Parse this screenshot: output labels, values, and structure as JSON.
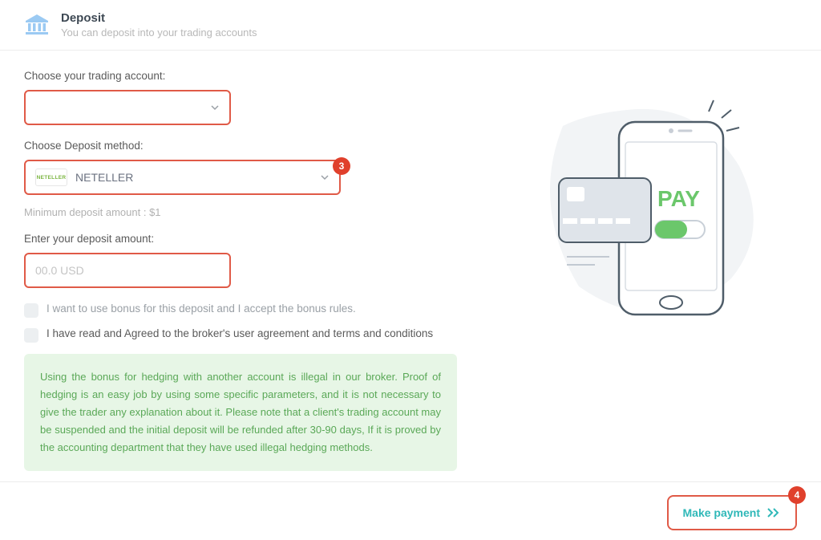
{
  "header": {
    "title": "Deposit",
    "subtitle": "You can deposit into your trading accounts"
  },
  "form": {
    "account_label": "Choose your trading account:",
    "method_label": "Choose Deposit method:",
    "method_selected": "NETELLER",
    "method_badge_logo": "NETELLER",
    "badge3": "3",
    "min_hint": "Minimum deposit amount : $1",
    "amount_label": "Enter your deposit amount:",
    "amount_placeholder": "00.0 USD",
    "bonus_check": "I want to use bonus for this deposit and I accept the bonus rules.",
    "agree_check": "I have read and Agreed to the broker's user agreement and terms and conditions",
    "info": "Using the bonus for hedging with another account is illegal in our broker. Proof of hedging is an easy job by using some specific parameters, and it is not necessary to give the trader any explanation about it. Please note that a client's trading account may be suspended and the initial deposit will be refunded after 30-90 days, If it is proved by the accounting department that they have used illegal hedging methods."
  },
  "illustration": {
    "pay_text": "PAY"
  },
  "footer": {
    "button": "Make payment",
    "badge4": "4"
  },
  "colors": {
    "accent_red": "#e05a47",
    "badge_red": "#e0402c",
    "teal": "#2fb8b8",
    "green": "#5aa857",
    "info_bg": "#e7f6e6"
  }
}
